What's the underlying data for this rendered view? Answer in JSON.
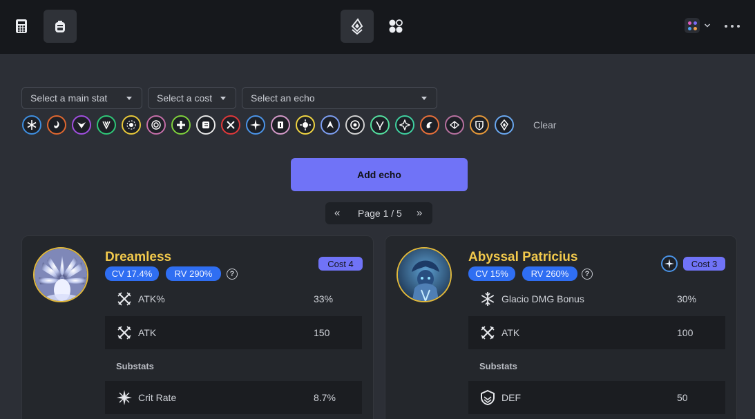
{
  "topbar": {
    "left_buttons": [
      {
        "icon": "calculator-icon"
      },
      {
        "icon": "backpack-icon",
        "active": true
      }
    ],
    "center_buttons": [
      {
        "icon": "echo-logo-icon",
        "active": true
      },
      {
        "icon": "grid-apps-icon"
      }
    ],
    "app_badge_colors": [
      "#e05cc0",
      "#7b6cf6",
      "#4ea0f0",
      "#f29f4a"
    ]
  },
  "filters": {
    "main_stat_placeholder": "Select a main stat",
    "cost_placeholder": "Select a cost",
    "echo_placeholder": "Select an echo",
    "clear_label": "Clear",
    "sets": [
      {
        "name": "freezing-frost",
        "color": "#3f8fe0"
      },
      {
        "name": "molten-rift",
        "color": "#e0672f"
      },
      {
        "name": "void-thunder",
        "color": "#a14fe0"
      },
      {
        "name": "sierra-gale",
        "color": "#2fc878"
      },
      {
        "name": "celestial-light",
        "color": "#e8c93a"
      },
      {
        "name": "sun-sinking-eclipse",
        "color": "#c56ea8"
      },
      {
        "name": "rejuvenating-glow",
        "color": "#7fd03c"
      },
      {
        "name": "moonlit-clouds",
        "color": "#e6e6e6"
      },
      {
        "name": "lingering-tunes",
        "color": "#e0383a"
      },
      {
        "name": "frosty-resolve",
        "color": "#4b94e8"
      },
      {
        "name": "eternal-radiance",
        "color": "#d59ac9"
      },
      {
        "name": "midnight-veil",
        "color": "#f0d542"
      },
      {
        "name": "empyrean-anthem",
        "color": "#7d9ef0"
      },
      {
        "name": "tidebreaking-courage",
        "color": "#d2d2d2"
      },
      {
        "name": "gusts-of-welkin",
        "color": "#54e0a0"
      },
      {
        "name": "windward-pilgrimage",
        "color": "#3fd0a0"
      },
      {
        "name": "flaming-clawprint",
        "color": "#e8703a"
      },
      {
        "name": "dream-of-the-lost",
        "color": "#b871a0"
      },
      {
        "name": "crown-of-valor",
        "color": "#e89a3a"
      },
      {
        "name": "law-of-harmony",
        "color": "#6aa8f0"
      }
    ]
  },
  "add_echo_label": "Add echo",
  "pager": {
    "prev": "«",
    "label": "Page 1 / 5",
    "next": "»"
  },
  "cards": [
    {
      "name": "Dreamless",
      "cv": "CV 17.4%",
      "rv": "RV 290%",
      "help": "?",
      "cost": "Cost 4",
      "main_stats": [
        {
          "icon": "atk-swords-icon",
          "label": "ATK%",
          "value": "33%"
        },
        {
          "icon": "atk-swords-icon",
          "label": "ATK",
          "value": "150"
        }
      ],
      "substats_label": "Substats",
      "substats": [
        {
          "icon": "crit-star-icon",
          "label": "Crit Rate",
          "value": "8.7%"
        }
      ]
    },
    {
      "name": "Abyssal Patricius",
      "cv": "CV 15%",
      "rv": "RV 260%",
      "help": "?",
      "cost": "Cost 3",
      "set_icon": "frosty-resolve",
      "main_stats": [
        {
          "icon": "glacio-snowflake-icon",
          "label": "Glacio DMG Bonus",
          "value": "30%"
        },
        {
          "icon": "atk-swords-icon",
          "label": "ATK",
          "value": "100"
        }
      ],
      "substats_label": "Substats",
      "substats": [
        {
          "icon": "def-shield-icon",
          "label": "DEF",
          "value": "50"
        }
      ]
    }
  ]
}
